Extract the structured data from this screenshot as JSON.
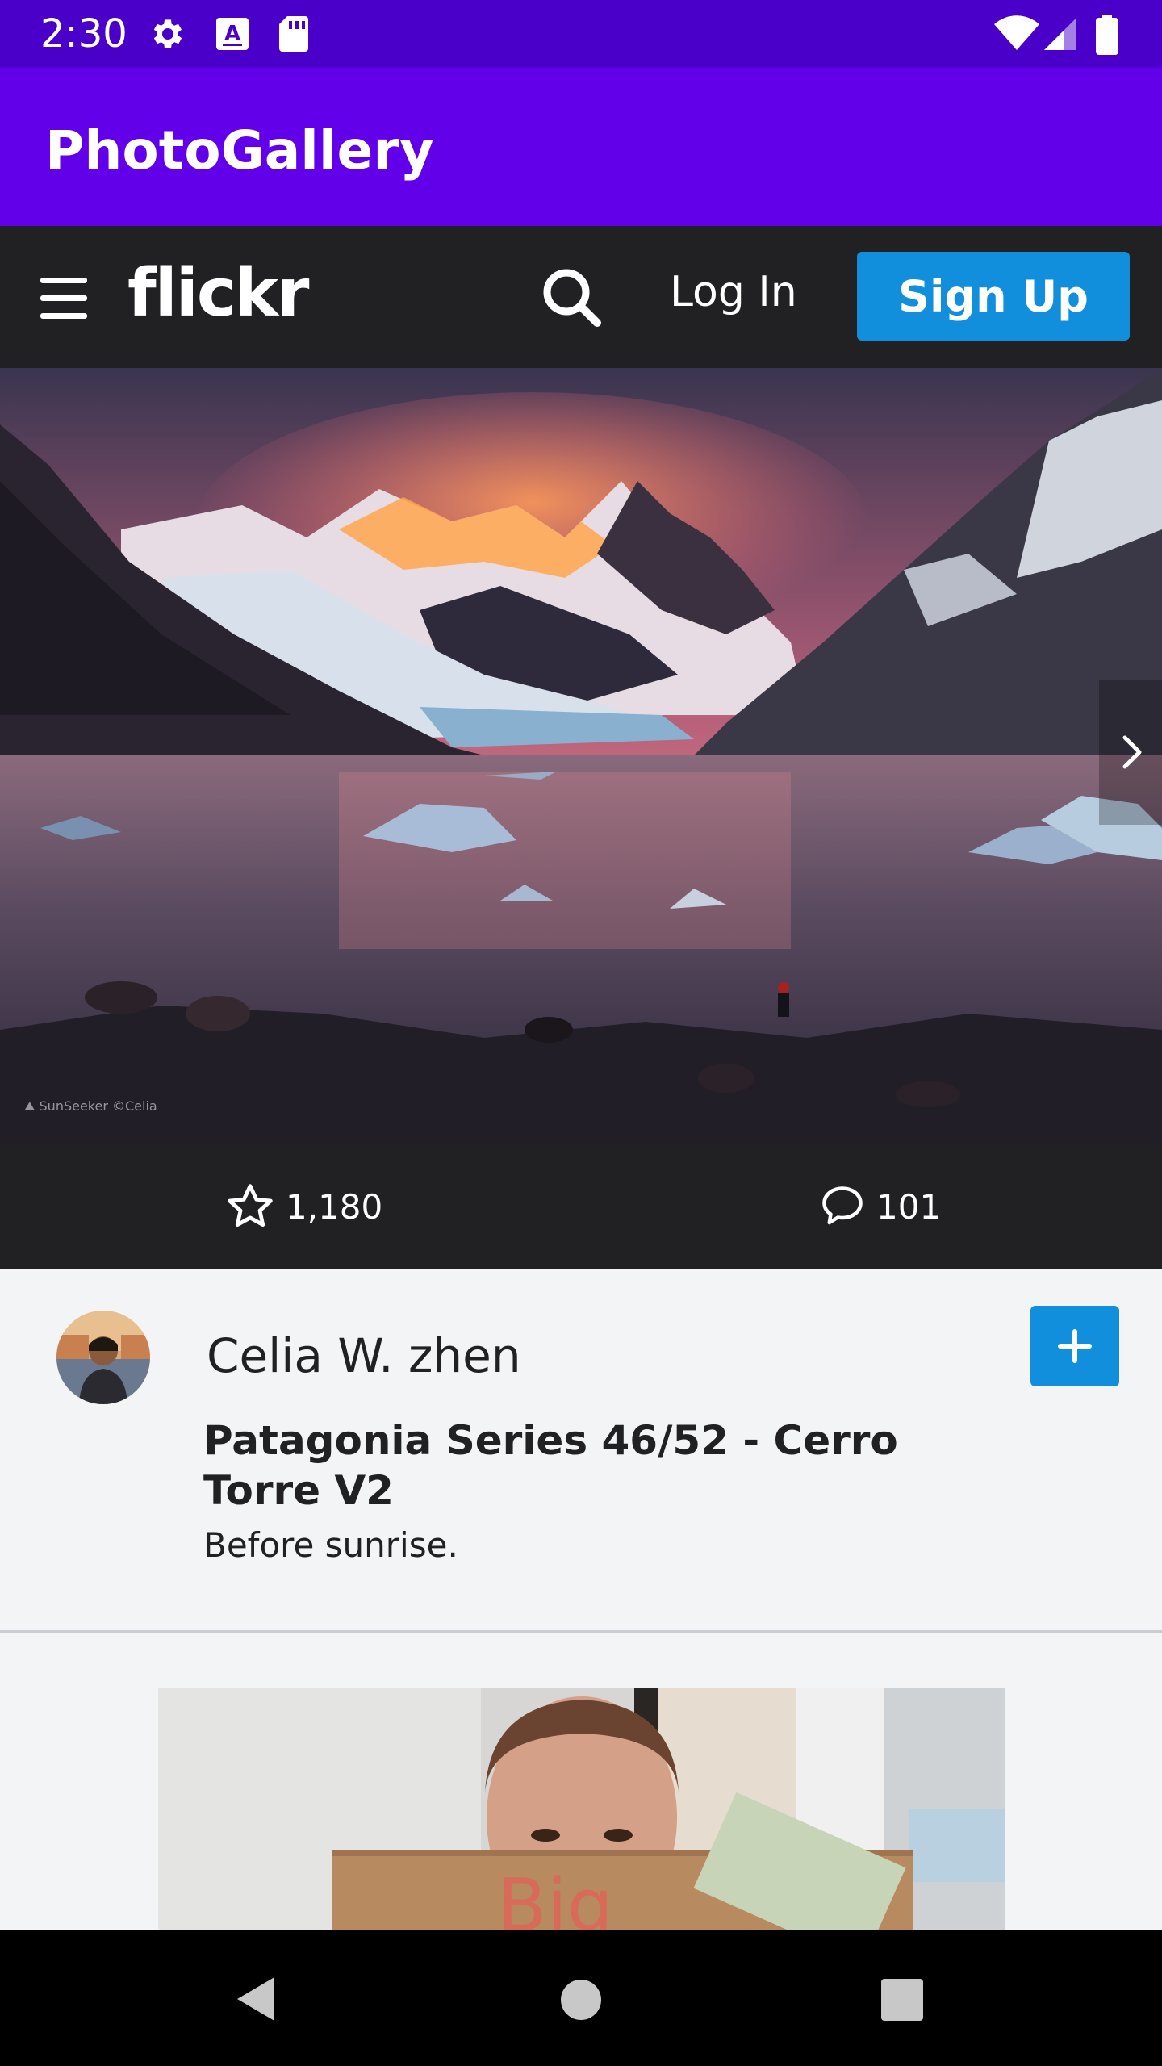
{
  "status": {
    "time": "2:30",
    "icons": [
      "gear-icon",
      "a-font-icon",
      "sd-card-icon",
      "wifi-icon",
      "signal-icon",
      "battery-icon"
    ]
  },
  "app": {
    "title": "PhotoGallery"
  },
  "flickr": {
    "logo": "flickr",
    "login_label": "Log In",
    "signup_label": "Sign Up",
    "accent": "#128fdc"
  },
  "photo": {
    "favorites": "1,180",
    "comments": "101",
    "author": "Celia W. zhen",
    "title": "Patagonia Series 46/52 - Cerro Torre V2",
    "description": "Before sunrise."
  },
  "second_photo": {
    "text": "Big"
  },
  "colors": {
    "status_bar": "#4a00c8",
    "app_bar": "#6200ea",
    "web_header": "#212124"
  }
}
